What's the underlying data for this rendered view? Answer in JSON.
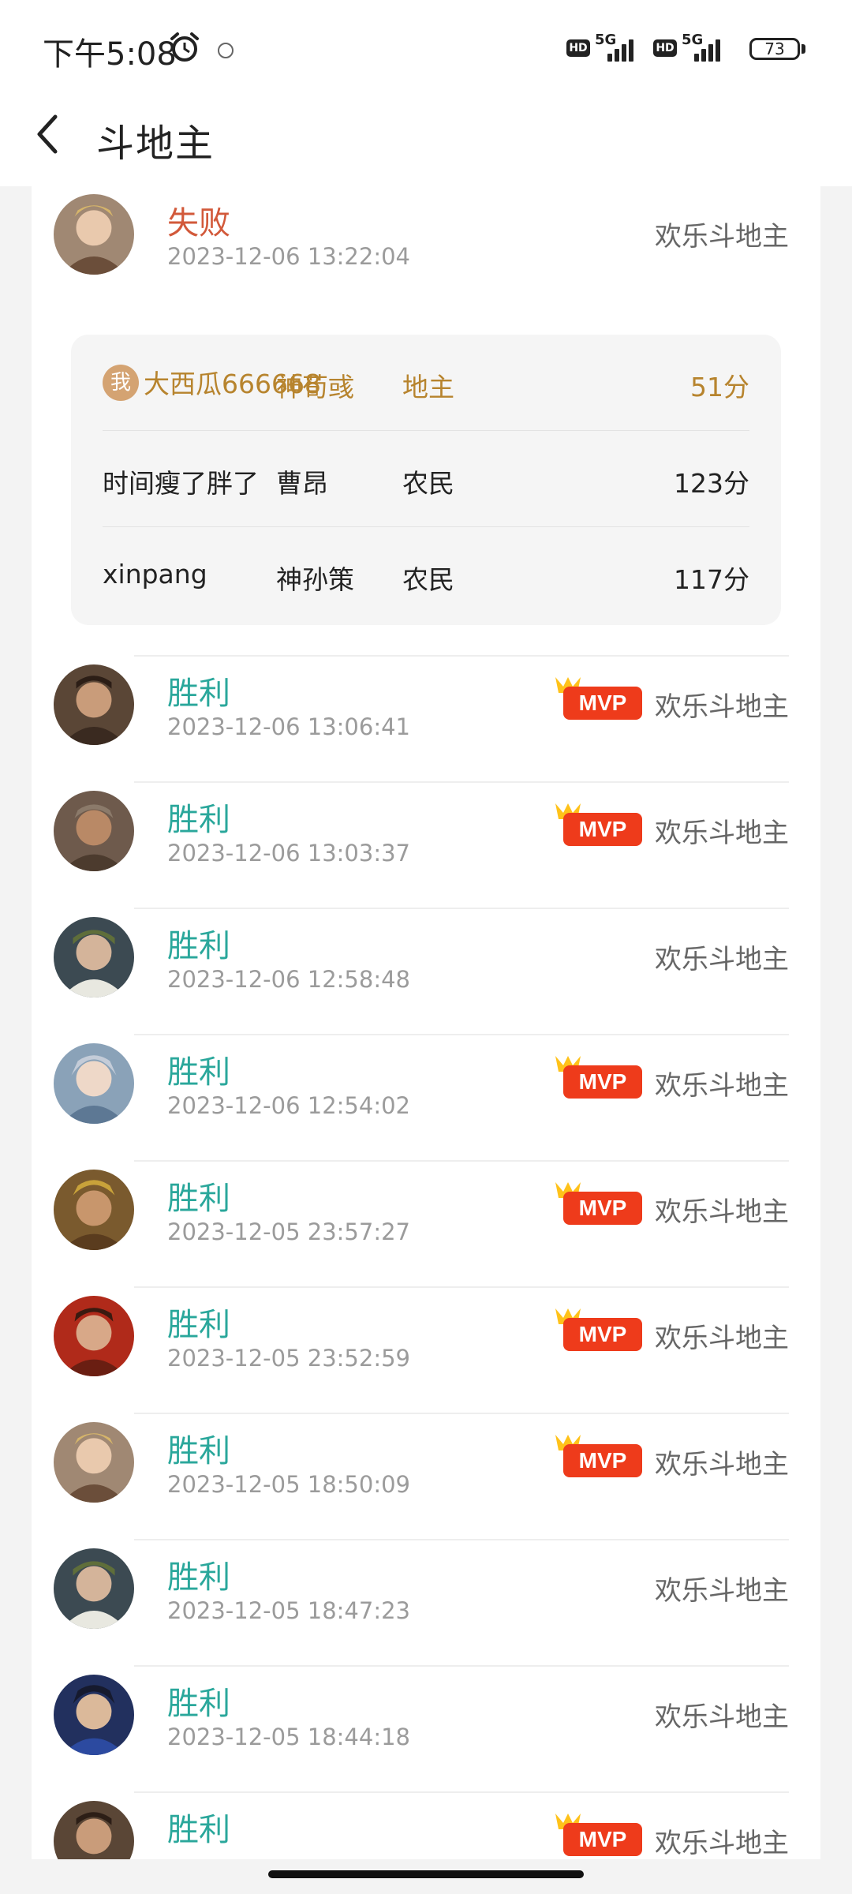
{
  "status_bar": {
    "time": "下午5:08",
    "hd": "HD",
    "network": "5G",
    "battery": "73"
  },
  "nav": {
    "title": "斗地主"
  },
  "mvp_label": "MVP",
  "first_record": {
    "result": "失败",
    "datetime": "2023-12-06 13:22:04",
    "mode": "欢乐斗地主",
    "players": [
      {
        "me_badge": "我",
        "name": "大西瓜666668",
        "hero": "神荀彧",
        "role": "地主",
        "score": "51分"
      },
      {
        "name": "时间瘦了胖了",
        "hero": "曹昂",
        "role": "农民",
        "score": "123分"
      },
      {
        "name": "xinpang",
        "hero": "神孙策",
        "role": "农民",
        "score": "117分"
      }
    ]
  },
  "records": [
    {
      "result": "胜利",
      "datetime": "2023-12-06 13:06:41",
      "mode": "欢乐斗地主",
      "mvp": true
    },
    {
      "result": "胜利",
      "datetime": "2023-12-06 13:03:37",
      "mode": "欢乐斗地主",
      "mvp": true
    },
    {
      "result": "胜利",
      "datetime": "2023-12-06 12:58:48",
      "mode": "欢乐斗地主",
      "mvp": false
    },
    {
      "result": "胜利",
      "datetime": "2023-12-06 12:54:02",
      "mode": "欢乐斗地主",
      "mvp": true
    },
    {
      "result": "胜利",
      "datetime": "2023-12-05 23:57:27",
      "mode": "欢乐斗地主",
      "mvp": true
    },
    {
      "result": "胜利",
      "datetime": "2023-12-05 23:52:59",
      "mode": "欢乐斗地主",
      "mvp": true
    },
    {
      "result": "胜利",
      "datetime": "2023-12-05 18:50:09",
      "mode": "欢乐斗地主",
      "mvp": true
    },
    {
      "result": "胜利",
      "datetime": "2023-12-05 18:47:23",
      "mode": "欢乐斗地主",
      "mvp": false
    },
    {
      "result": "胜利",
      "datetime": "2023-12-05 18:44:18",
      "mode": "欢乐斗地主",
      "mvp": false
    },
    {
      "result": "胜利",
      "datetime": "",
      "mode": "欢乐斗地主",
      "mvp": true
    }
  ],
  "colors": {
    "win": "#2aa79b",
    "lose": "#d2593a",
    "me": "#b7842e",
    "mvp": "#ee3b1b"
  }
}
